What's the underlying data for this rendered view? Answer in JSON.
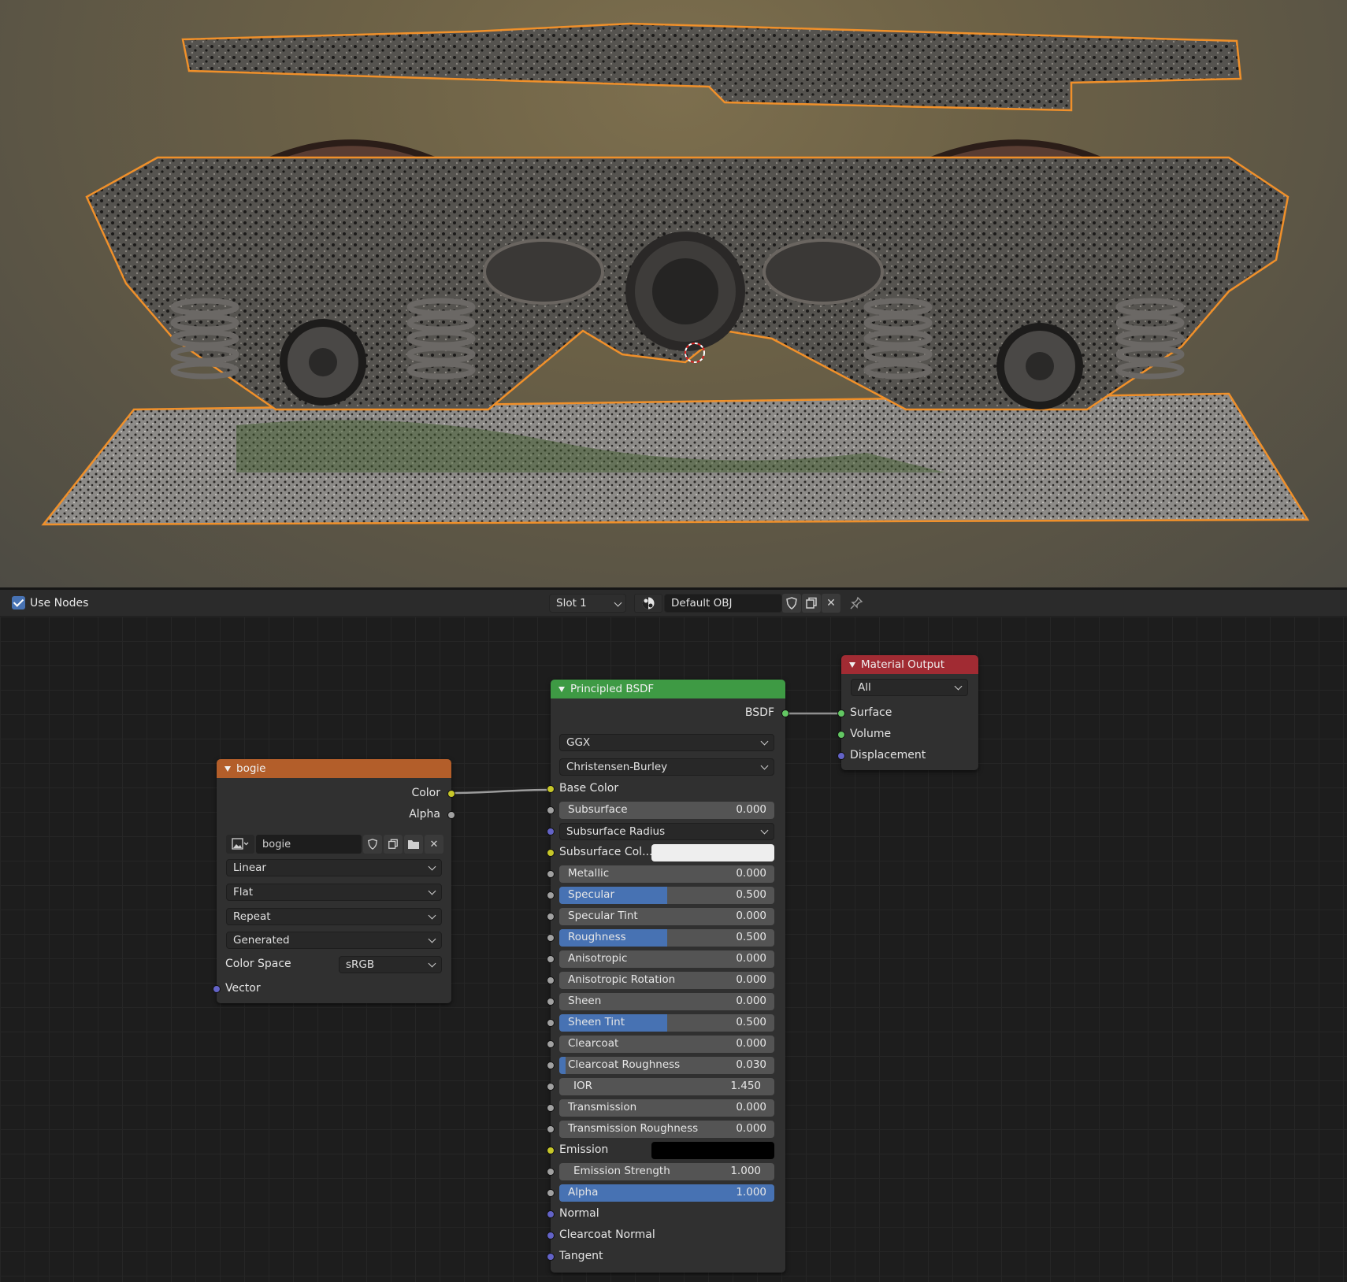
{
  "header": {
    "use_nodes_label": "Use Nodes",
    "use_nodes_checked": true,
    "slot": "Slot 1",
    "material_name": "Default OBJ"
  },
  "nodes": {
    "image_texture": {
      "title": "bogie",
      "outputs": [
        "Color",
        "Alpha"
      ],
      "image_name": "bogie",
      "interpolation": "Linear",
      "projection": "Flat",
      "extension": "Repeat",
      "source": "Generated",
      "color_space_label": "Color Space",
      "color_space": "sRGB",
      "vector_label": "Vector"
    },
    "principled": {
      "title": "Principled BSDF",
      "output": "BSDF",
      "distribution": "GGX",
      "subsurface_method": "Christensen-Burley",
      "base_color_label": "Base Color",
      "subsurface": {
        "label": "Subsurface",
        "value": "0.000"
      },
      "subsurface_radius_label": "Subsurface Radius",
      "subsurface_color_label": "Subsurface Col...",
      "metallic": {
        "label": "Metallic",
        "value": "0.000"
      },
      "specular": {
        "label": "Specular",
        "value": "0.500",
        "fill": 0.5
      },
      "specular_tint": {
        "label": "Specular Tint",
        "value": "0.000"
      },
      "roughness": {
        "label": "Roughness",
        "value": "0.500",
        "fill": 0.5
      },
      "anisotropic": {
        "label": "Anisotropic",
        "value": "0.000"
      },
      "anisotropic_rotation": {
        "label": "Anisotropic Rotation",
        "value": "0.000"
      },
      "sheen": {
        "label": "Sheen",
        "value": "0.000"
      },
      "sheen_tint": {
        "label": "Sheen Tint",
        "value": "0.500",
        "fill": 0.5
      },
      "clearcoat": {
        "label": "Clearcoat",
        "value": "0.000"
      },
      "clearcoat_roughness": {
        "label": "Clearcoat Roughness",
        "value": "0.030",
        "fill": 0.03
      },
      "ior": {
        "label": "IOR",
        "value": "1.450"
      },
      "transmission": {
        "label": "Transmission",
        "value": "0.000"
      },
      "transmission_roughness": {
        "label": "Transmission Roughness",
        "value": "0.000"
      },
      "emission_label": "Emission",
      "emission_strength": {
        "label": "Emission Strength",
        "value": "1.000"
      },
      "alpha": {
        "label": "Alpha",
        "value": "1.000",
        "fill": 1.0
      },
      "normal_label": "Normal",
      "clearcoat_normal_label": "Clearcoat Normal",
      "tangent_label": "Tangent"
    },
    "material_output": {
      "title": "Material Output",
      "target": "All",
      "surface_label": "Surface",
      "volume_label": "Volume",
      "displacement_label": "Displacement"
    }
  },
  "colors": {
    "texture_header": "#b35e2a",
    "shader_header": "#3e9a44",
    "output_header": "#a12b33",
    "slider_fill": "#4772b3",
    "selection_outline": "#f0902a",
    "subsurface_color": "#eeeeee",
    "emission_color": "#000000"
  }
}
